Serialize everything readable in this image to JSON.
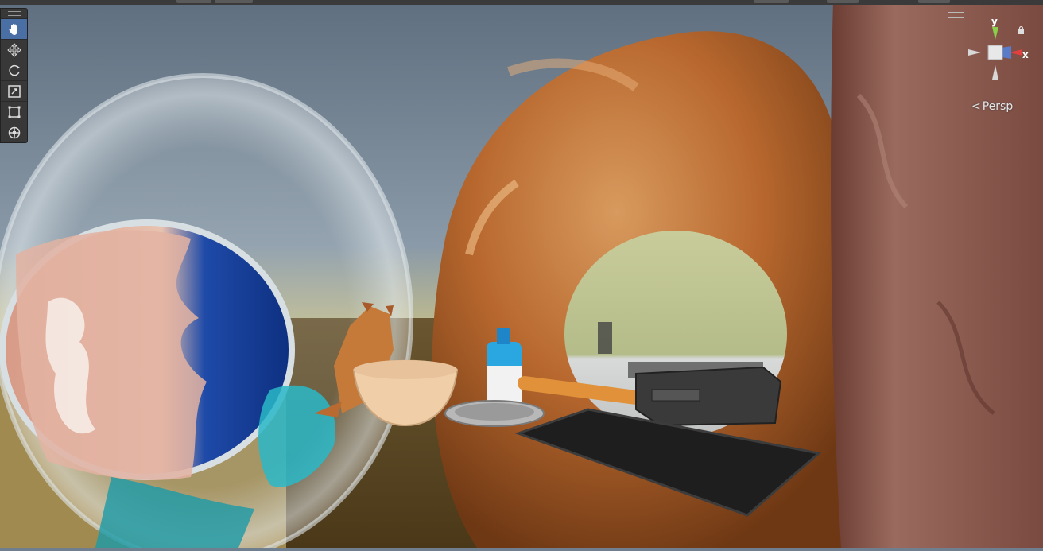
{
  "toolbar": {
    "tools": [
      {
        "name": "hand-tool",
        "active": true
      },
      {
        "name": "move-tool",
        "active": false
      },
      {
        "name": "rotate-tool",
        "active": false
      },
      {
        "name": "scale-tool",
        "active": false
      },
      {
        "name": "rect-tool",
        "active": false
      },
      {
        "name": "transform-tool",
        "active": false
      }
    ]
  },
  "gizmo": {
    "y_label": "y",
    "x_label": "x",
    "projection_label": "Persp"
  },
  "colors": {
    "active_tool": "#4a6fa5",
    "toolbar_bg": "#383838",
    "y_axis": "#8bd04a",
    "x_axis": "#e04040"
  }
}
